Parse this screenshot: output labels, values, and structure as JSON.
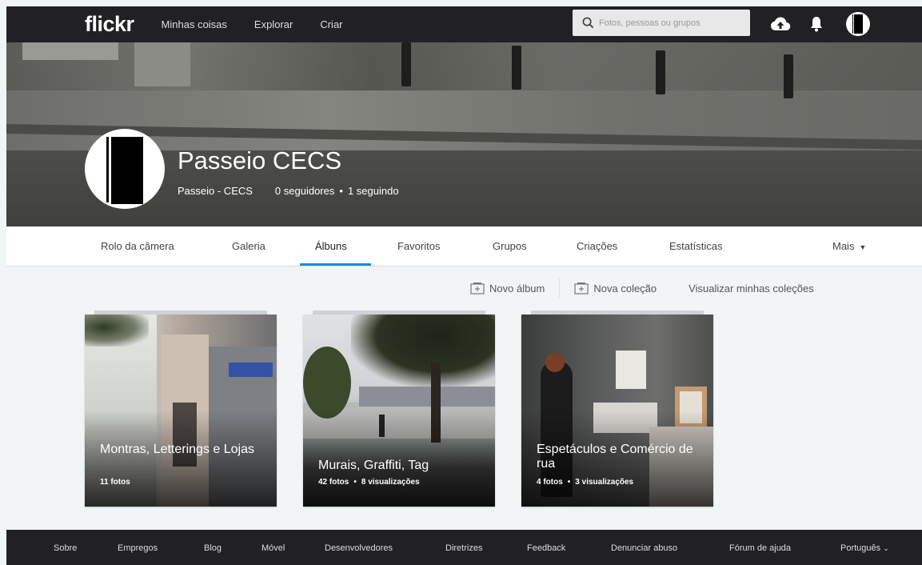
{
  "header": {
    "logo": "flickr",
    "nav": [
      "Minhas coisas",
      "Explorar",
      "Criar"
    ],
    "search_placeholder": "Fotos, pessoas ou grupos"
  },
  "profile": {
    "name": "Passeio CECS",
    "username": "Passeio - CECS",
    "followers": "0 seguidores",
    "following": "1 seguindo"
  },
  "subnav": {
    "tabs": [
      "Rolo da câmera",
      "Galeria",
      "Álbuns",
      "Favoritos",
      "Grupos",
      "Criações",
      "Estatísticas"
    ],
    "active": "Álbuns",
    "more": "Mais"
  },
  "actions": {
    "new_album": "Novo álbum",
    "new_collection": "Nova coleção",
    "view_collections": "Visualizar minhas coleções"
  },
  "albums": [
    {
      "title": "Montras, Letterings e Lojas",
      "photos": "11 fotos",
      "views": ""
    },
    {
      "title": "Murais, Graffiti, Tag",
      "photos": "42 fotos",
      "views": "8 visualizações"
    },
    {
      "title": "Espetáculos e Comércio de rua",
      "photos": "4 fotos",
      "views": "3 visualizações"
    }
  ],
  "footer": {
    "links": [
      "Sobre",
      "Empregos",
      "Blog",
      "Móvel",
      "Desenvolvedores",
      "Diretrizes",
      "Feedback",
      "Denunciar abuso",
      "Fórum de ajuda"
    ],
    "language": "Português"
  },
  "colors": {
    "bar": "#212124",
    "accent": "#128fdc",
    "page_bg": "#f2f5f6"
  }
}
